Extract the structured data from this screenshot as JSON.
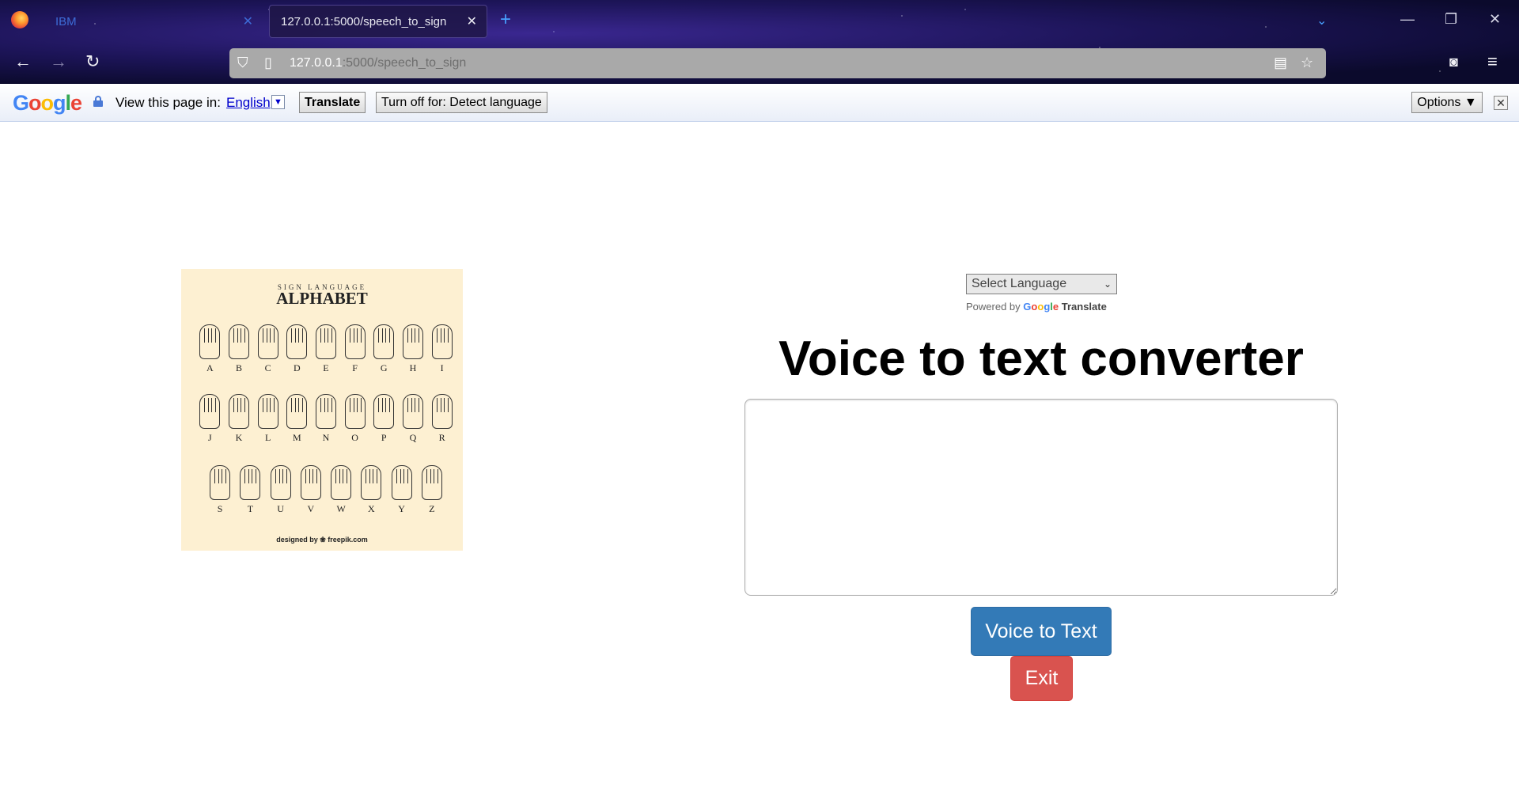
{
  "browser": {
    "tabs": [
      {
        "title": "IBM",
        "active": false
      },
      {
        "title": "127.0.0.1:5000/speech_to_sign",
        "active": true
      }
    ],
    "url_host": "127.0.0.1",
    "url_rest": ":5000/speech_to_sign"
  },
  "translate_bar": {
    "view_label": "View this page in:",
    "language": "English",
    "translate_button": "Translate",
    "turn_off_button": "Turn off for: Detect language",
    "options_button": "Options ▼",
    "close": "✕"
  },
  "poster": {
    "subtitle": "SIGN LANGUAGE",
    "title": "ALPHABET",
    "rows": [
      [
        "A",
        "B",
        "C",
        "D",
        "E",
        "F",
        "G",
        "H",
        "I"
      ],
      [
        "J",
        "K",
        "L",
        "M",
        "N",
        "O",
        "P",
        "Q",
        "R"
      ],
      [
        "S",
        "T",
        "U",
        "V",
        "W",
        "X",
        "Y",
        "Z"
      ]
    ],
    "credit": "designed by ❀ freepik.com"
  },
  "main": {
    "language_select": "Select Language",
    "powered_by": "Powered by",
    "google_word": "Google",
    "translate_word": "Translate",
    "title": "Voice to text converter",
    "textarea_value": "",
    "voice_button": "Voice to Text",
    "exit_button": "Exit"
  },
  "colors": {
    "voice_button": "#337ab7",
    "exit_button": "#d9534f"
  }
}
